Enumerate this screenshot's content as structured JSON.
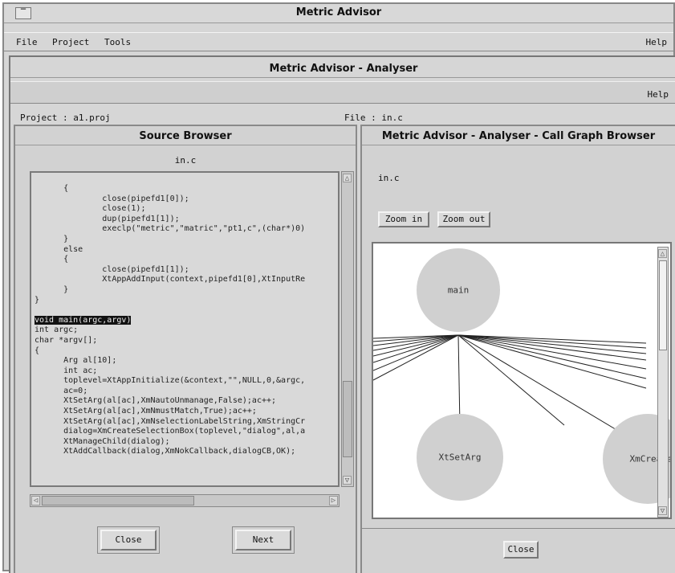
{
  "main_window": {
    "title": "Metric Advisor",
    "menu": {
      "file": "File",
      "project": "Project",
      "tools": "Tools",
      "help": "Help"
    }
  },
  "analyser": {
    "title": "Metric Advisor - Analyser",
    "help": "Help",
    "project_label": "Project : a1.proj",
    "file_label": "File : in.c"
  },
  "source_browser": {
    "title": "Source Browser",
    "filename": "in.c",
    "code_lines": [
      "      {",
      "              close(pipefd1[0]);",
      "              close(1);",
      "              dup(pipefd1[1]);",
      "              execlp(\"metric\",\"matric\",\"pt1,c\",(char*)0)",
      "      }",
      "      else",
      "      {",
      "              close(pipefd1[1]);",
      "              XtAppAddInput(context,pipefd1[0],XtInputRe",
      "      }",
      "}",
      "",
      "void main(argc,argv)",
      "int argc;",
      "char *argv[];",
      "{",
      "      Arg al[10];",
      "      int ac;",
      "      toplevel=XtAppInitialize(&context,\"\",NULL,0,&argc,",
      "      ac=0;",
      "      XtSetArg(al[ac],XmNautoUnmanage,False);ac++;",
      "      XtSetArg(al[ac],XmNmustMatch,True);ac++;",
      "      XtSetArg(al[ac],XmNselectionLabelString,XmStringCr",
      "      dialog=XmCreateSelectionBox(toplevel,\"dialog\",al,a",
      "      XtManageChild(dialog);",
      "      XtAddCallback(dialog,XmNokCallback,dialogCB,OK);"
    ],
    "highlighted_line": "void main(argc,argv)",
    "close_label": "Close",
    "next_label": "Next"
  },
  "call_graph": {
    "title": "Metric Advisor - Analyser - Call Graph Browser",
    "filename": "in.c",
    "zoom_in_label": "Zoom  in",
    "zoom_out_label": "Zoom  out",
    "nodes": {
      "main": "main",
      "xtsetarg": "XtSetArg",
      "xmcreate": "XmCreate"
    },
    "close_label": "Close"
  },
  "colors": {
    "window_bg": "#d6d6d6",
    "node_fill": "#d0d0d0",
    "canvas_bg": "#ffffff",
    "highlight": "#111111"
  }
}
